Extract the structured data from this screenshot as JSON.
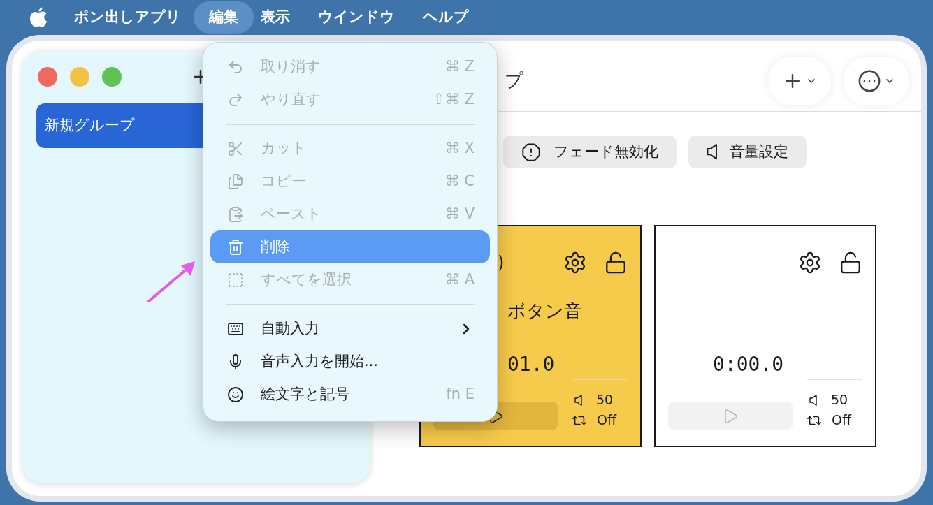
{
  "menubar": {
    "items": [
      {
        "label": "ポン出しアプリ",
        "kind": "app",
        "selected": false
      },
      {
        "label": "編集",
        "kind": "menu",
        "selected": true
      },
      {
        "label": "表示",
        "kind": "menu",
        "selected": false
      },
      {
        "label": "ウインドウ",
        "kind": "menu",
        "selected": false
      },
      {
        "label": "ヘルプ",
        "kind": "menu",
        "selected": false
      }
    ]
  },
  "sidebar": {
    "items": [
      {
        "label": "新規グループ",
        "selected": true
      }
    ]
  },
  "toolbar": {
    "title": "プ"
  },
  "chips": [
    {
      "label": "フェード無効化"
    },
    {
      "label": "音量設定"
    }
  ],
  "cards": [
    {
      "color": "#f6ca4a",
      "name": ")",
      "title": "ボタン音",
      "time": "01.0",
      "volume": "50",
      "loop": "Off",
      "play_disabled": false
    },
    {
      "color": "#ffffff",
      "time": "0:00.0",
      "volume": "50",
      "loop": "Off",
      "play_disabled": true
    }
  ],
  "edit_menu": {
    "items": [
      {
        "kind": "item",
        "label": "取り消す",
        "shortcut": "⌘ Z",
        "disabled": true,
        "selected": false,
        "submenu": false
      },
      {
        "kind": "item",
        "label": "やり直す",
        "shortcut": "⇧⌘ Z",
        "disabled": true,
        "selected": false,
        "submenu": false
      },
      {
        "kind": "separator"
      },
      {
        "kind": "item",
        "label": "カット",
        "shortcut": "⌘ X",
        "disabled": true,
        "selected": false,
        "submenu": false
      },
      {
        "kind": "item",
        "label": "コピー",
        "shortcut": "⌘ C",
        "disabled": true,
        "selected": false,
        "submenu": false
      },
      {
        "kind": "item",
        "label": "ペースト",
        "shortcut": "⌘ V",
        "disabled": true,
        "selected": false,
        "submenu": false
      },
      {
        "kind": "item",
        "label": "削除",
        "disabled": false,
        "selected": true,
        "submenu": false
      },
      {
        "kind": "item",
        "label": "すべてを選択",
        "shortcut": "⌘ A",
        "disabled": true,
        "selected": false,
        "submenu": false
      },
      {
        "kind": "separator"
      },
      {
        "kind": "item",
        "label": "自動入力",
        "disabled": false,
        "selected": false,
        "submenu": true
      },
      {
        "kind": "item",
        "label": "音声入力を開始...",
        "disabled": false,
        "selected": false,
        "submenu": false
      },
      {
        "kind": "item",
        "label": "絵文字と記号",
        "shortcut": "fn E",
        "disabled": false,
        "selected": false,
        "submenu": false
      }
    ]
  }
}
